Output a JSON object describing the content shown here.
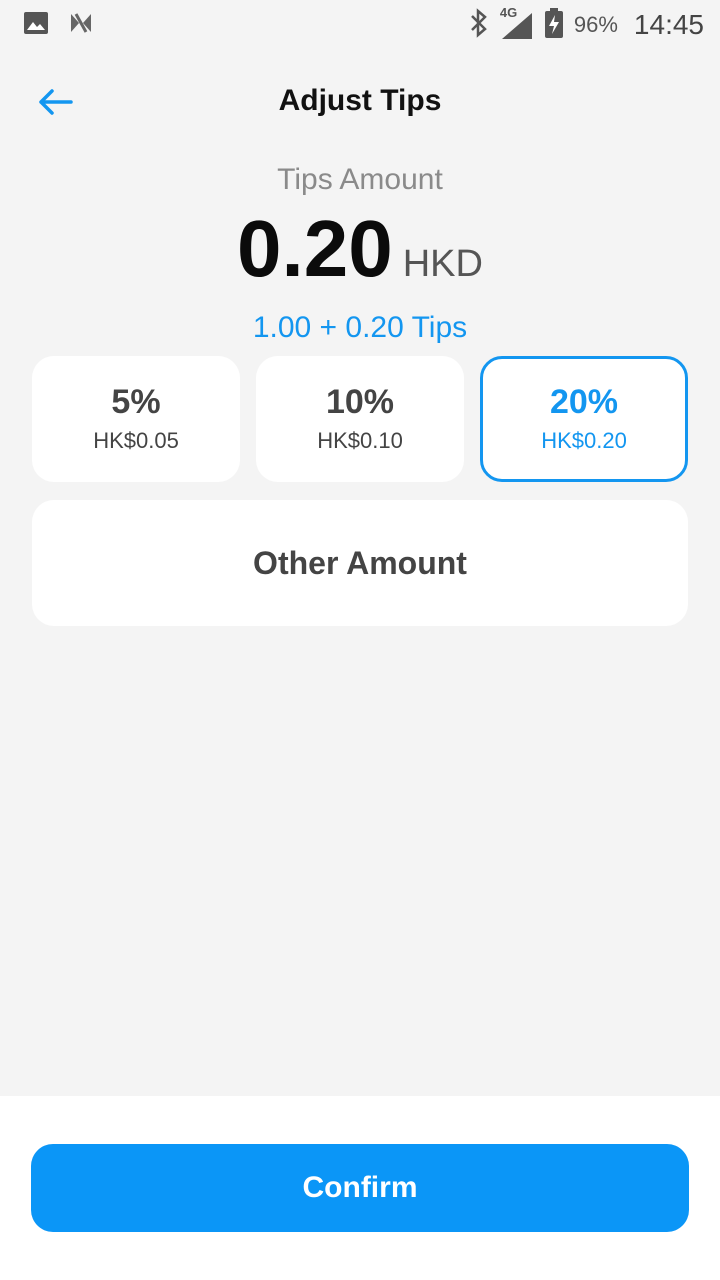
{
  "status_bar": {
    "left_icons": [
      "image-icon",
      "app-notification-icon"
    ],
    "right_icons": [
      "bluetooth-icon",
      "signal-4g-icon",
      "battery-charging-icon"
    ],
    "network": "4G",
    "battery": "96%",
    "time": "14:45"
  },
  "header": {
    "title": "Adjust Tips",
    "back_icon": "arrow-left-icon"
  },
  "tips": {
    "label": "Tips Amount",
    "amount": "0.20",
    "currency": "HKD",
    "breakdown": "1.00 + 0.20 Tips"
  },
  "options": [
    {
      "percent": "5%",
      "amount": "HK$0.05",
      "selected": false
    },
    {
      "percent": "10%",
      "amount": "HK$0.10",
      "selected": false
    },
    {
      "percent": "20%",
      "amount": "HK$0.20",
      "selected": true
    }
  ],
  "other_amount_label": "Other Amount",
  "confirm_label": "Confirm",
  "colors": {
    "accent": "#1396f0",
    "button": "#0b96f7",
    "background": "#f4f4f4"
  }
}
